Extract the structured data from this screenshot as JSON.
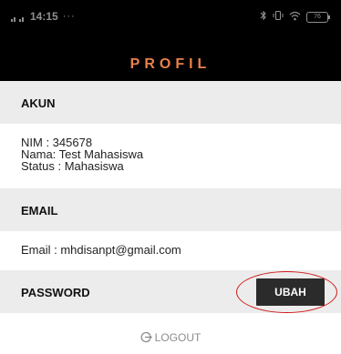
{
  "status_bar": {
    "signal_top": "H",
    "signal_bottom": "26",
    "time": "14:15",
    "dots": "···",
    "battery": "76"
  },
  "header": {
    "title": "PROFIL"
  },
  "akun": {
    "heading": "AKUN",
    "nim": "NIM : 345678",
    "nama": "Nama: Test Mahasiswa",
    "status": "Status : Mahasiswa"
  },
  "email": {
    "heading": "EMAIL",
    "value": "Email : mhdisanpt@gmail.com"
  },
  "password": {
    "heading": "PASSWORD",
    "button_label": "UBAH"
  },
  "logout": {
    "label": "LOGOUT"
  },
  "colors": {
    "header_bg": "#000000",
    "title": "#e8814a",
    "section_bg": "#ececec",
    "button_bg": "#2b2b2b",
    "highlight": "#d11c1c"
  }
}
